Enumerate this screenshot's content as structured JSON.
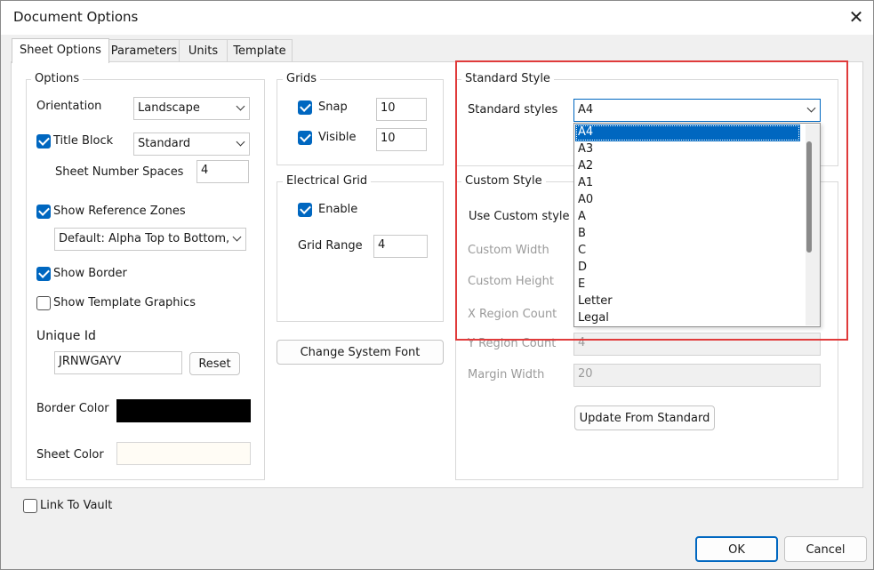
{
  "window": {
    "title": "Document Options"
  },
  "tabs": [
    {
      "label": "Sheet Options",
      "active": true
    },
    {
      "label": "Parameters"
    },
    {
      "label": "Units"
    },
    {
      "label": "Template"
    }
  ],
  "options": {
    "group_label": "Options",
    "orientation_label": "Orientation",
    "orientation_value": "Landscape",
    "title_block_label": "Title Block",
    "title_block_value": "Standard",
    "sheet_number_spaces_label": "Sheet Number Spaces",
    "sheet_number_spaces_value": "4",
    "show_reference_zones_label": "Show Reference Zones",
    "reference_zones_value": "Default: Alpha Top to Bottom,",
    "show_border_label": "Show Border",
    "show_template_graphics_label": "Show Template Graphics",
    "unique_id_label": "Unique Id",
    "unique_id_value": "JRNWGAYV",
    "reset_label": "Reset",
    "border_color_label": "Border Color",
    "border_color": "#000000",
    "sheet_color_label": "Sheet Color",
    "sheet_color": "#fffcf5"
  },
  "grids": {
    "group_label": "Grids",
    "snap_label": "Snap",
    "snap_value": "10",
    "visible_label": "Visible",
    "visible_value": "10"
  },
  "electrical_grid": {
    "group_label": "Electrical Grid",
    "enable_label": "Enable",
    "grid_range_label": "Grid Range",
    "grid_range_value": "4"
  },
  "change_font_label": "Change System Font",
  "standard_style": {
    "group_label": "Standard Style",
    "styles_label": "Standard styles",
    "styles_value": "A4",
    "options": [
      "A4",
      "A3",
      "A2",
      "A1",
      "A0",
      "A",
      "B",
      "C",
      "D",
      "E",
      "Letter",
      "Legal"
    ]
  },
  "custom_style": {
    "group_label": "Custom Style",
    "use_custom_label": "Use Custom style",
    "custom_width_label": "Custom Width",
    "custom_height_label": "Custom Height",
    "x_region_label": "X Region Count",
    "y_region_label": "Y Region Count",
    "y_region_value": "4",
    "margin_width_label": "Margin Width",
    "margin_width_value": "20",
    "update_label": "Update From Standard"
  },
  "link_to_vault_label": "Link To Vault",
  "ok_label": "OK",
  "cancel_label": "Cancel",
  "colors": {
    "accent": "#0067c0",
    "highlight": "#e03b3b"
  }
}
